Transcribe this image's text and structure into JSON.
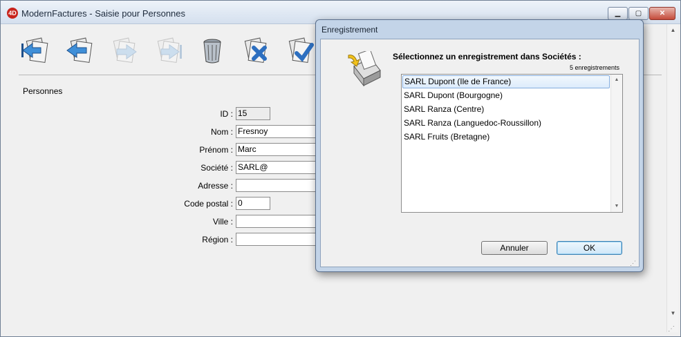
{
  "window": {
    "title": "ModernFactures - Saisie pour  Personnes",
    "app_icon": "4D",
    "controls": {
      "minimize": "▁",
      "maximize": "▢",
      "close": "✕"
    }
  },
  "toolbar": {
    "icons": [
      "first-record-icon",
      "previous-record-icon",
      "next-record-icon",
      "last-record-icon",
      "trash-icon",
      "cancel-icon",
      "accept-icon"
    ]
  },
  "form": {
    "section_title": "Personnes",
    "fields": [
      {
        "label": "ID :",
        "value": "15"
      },
      {
        "label": "Nom :",
        "value": "Fresnoy"
      },
      {
        "label": "Prénom :",
        "value": "Marc"
      },
      {
        "label": "Société :",
        "value": "SARL@"
      },
      {
        "label": "Adresse :",
        "value": ""
      },
      {
        "label": "Code postal :",
        "value": "0"
      },
      {
        "label": "Ville :",
        "value": ""
      },
      {
        "label": "Région :",
        "value": ""
      }
    ]
  },
  "dialog": {
    "title": "Enregistrement",
    "prompt": "Sélectionnez un enregistrement dans Sociétés :",
    "count_label": "5 enregistrements",
    "records": [
      "SARL Dupont  (Ile de France)",
      "SARL Dupont  (Bourgogne)",
      "SARL Ranza  (Centre)",
      "SARL Ranza  (Languedoc-Roussillon)",
      "SARL Fruits  (Bretagne)"
    ],
    "selected_index": 0,
    "cancel_label": "Annuler",
    "ok_label": "OK"
  },
  "scroll": {
    "up": "▲",
    "down": "▼"
  },
  "colors": {
    "accent": "#3c7fb1",
    "selection": "#dcebfc",
    "close_button": "#c44b3a"
  }
}
